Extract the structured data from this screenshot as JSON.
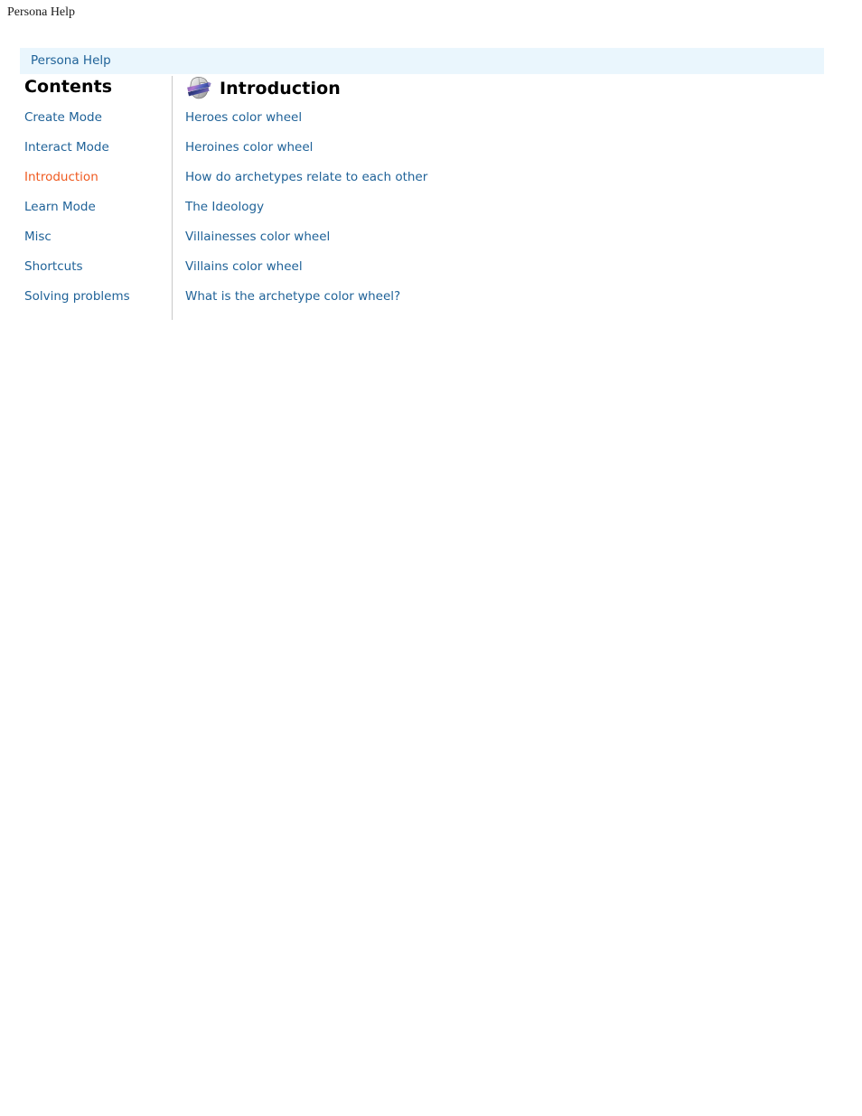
{
  "page": {
    "browser_header_title": "Persona Help"
  },
  "titlebar": {
    "link_label": "Persona Help",
    "background_color": "#eaf6fd",
    "link_color": "#1f6298"
  },
  "sidebar": {
    "heading": "Contents",
    "items": [
      {
        "label": "Create Mode",
        "active": false
      },
      {
        "label": "Interact Mode",
        "active": false
      },
      {
        "label": "Introduction",
        "active": true
      },
      {
        "label": "Learn Mode",
        "active": false
      },
      {
        "label": "Misc",
        "active": false
      },
      {
        "label": "Shortcuts",
        "active": false
      },
      {
        "label": "Solving problems",
        "active": false
      }
    ],
    "link_color": "#1f6298",
    "active_link_color": "#ef5a20"
  },
  "main": {
    "icon": "persona-mask-icon",
    "heading": "Introduction",
    "topics": [
      {
        "label": "Heroes color wheel"
      },
      {
        "label": "Heroines color wheel"
      },
      {
        "label": "How do archetypes relate to each other"
      },
      {
        "label": "The Ideology"
      },
      {
        "label": "Villainesses color wheel"
      },
      {
        "label": "Villains color wheel"
      },
      {
        "label": "What is the archetype color wheel?"
      }
    ],
    "link_color": "#1f6298"
  }
}
